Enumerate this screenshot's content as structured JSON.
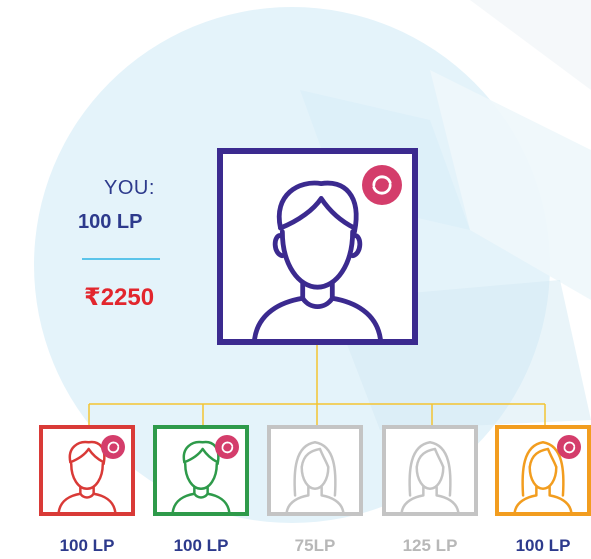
{
  "you": {
    "label": "YOU:",
    "lp": "100 LP",
    "amount": "₹2250"
  },
  "main_node": {
    "avatar_icon": "male-user-icon",
    "badge_icon": "refresh-icon",
    "border_color": "#3b2a8f"
  },
  "children": [
    {
      "label": "100 LP",
      "avatar_icon": "male-user-icon",
      "color": "#d93a37",
      "active": true
    },
    {
      "label": "100 LP",
      "avatar_icon": "male-user-icon",
      "color": "#2e9a4a",
      "active": true
    },
    {
      "label": "75LP",
      "avatar_icon": "female-user-icon",
      "color": "#c4c4c4",
      "active": false
    },
    {
      "label": "125 LP",
      "avatar_icon": "female-user-icon",
      "color": "#c4c4c4",
      "active": false
    },
    {
      "label": "100 LP",
      "avatar_icon": "female-user-icon",
      "color": "#f29d1f",
      "active": true
    }
  ],
  "colors": {
    "connector": "#f3c432",
    "badge": "#d43d6b",
    "label_active": "#2d3a8c",
    "label_inactive": "#b8b8b8",
    "amount": "#e2262d",
    "background_circle": "#e4f3fa"
  }
}
